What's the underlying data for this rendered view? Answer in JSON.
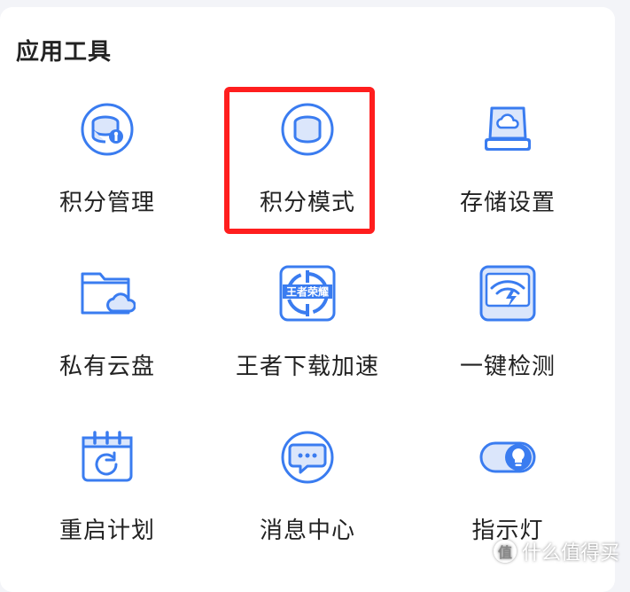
{
  "section": {
    "title": "应用工具"
  },
  "tools": [
    {
      "label": "积分管理",
      "icon": "points-management-icon"
    },
    {
      "label": "积分模式",
      "icon": "points-mode-icon"
    },
    {
      "label": "存储设置",
      "icon": "storage-settings-icon"
    },
    {
      "label": "私有云盘",
      "icon": "private-cloud-folder-icon"
    },
    {
      "label": "王者下载加速",
      "icon": "game-download-accelerate-icon",
      "icon_text": "王者荣耀"
    },
    {
      "label": "一键检测",
      "icon": "one-click-detect-icon"
    },
    {
      "label": "重启计划",
      "icon": "restart-schedule-icon"
    },
    {
      "label": "消息中心",
      "icon": "message-center-icon"
    },
    {
      "label": "指示灯",
      "icon": "indicator-light-icon"
    }
  ],
  "highlight": {
    "target": "积分模式",
    "color": "#ff1e1e"
  },
  "watermark": {
    "badge": "值",
    "text": "什么值得买"
  },
  "colors": {
    "accent": "#3a7cf0",
    "accent_light": "#dbe6fb"
  }
}
